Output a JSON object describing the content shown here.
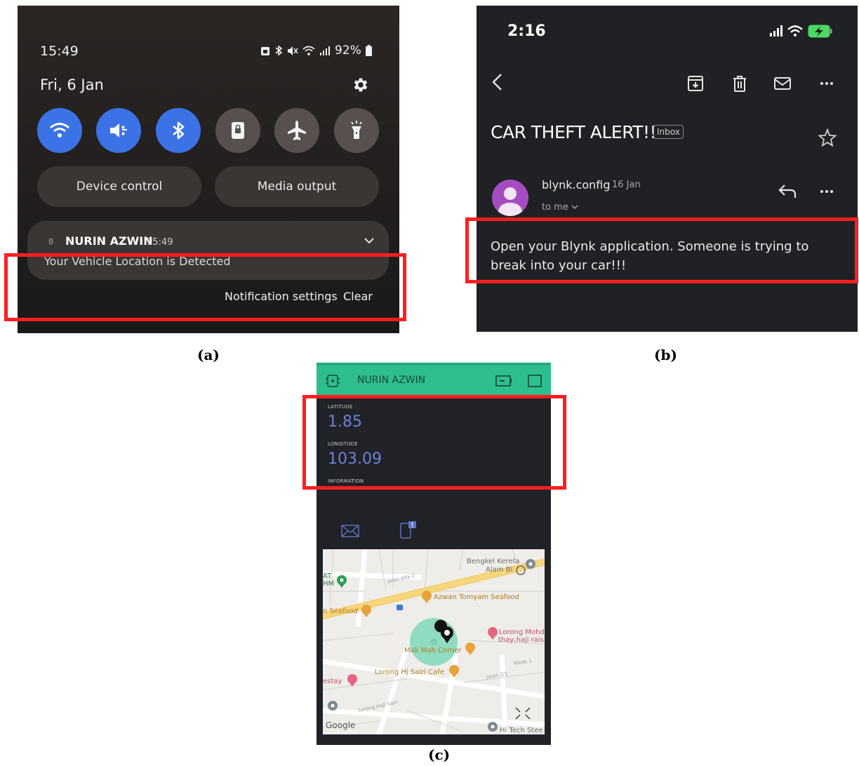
{
  "panel_a": {
    "time": "15:49",
    "battery": "92%",
    "date": "Fri, 6 Jan",
    "quick_settings": [
      {
        "icon": "wifi-icon",
        "on": true
      },
      {
        "icon": "sound-muted-icon",
        "on": true
      },
      {
        "icon": "bluetooth-icon",
        "on": true
      },
      {
        "icon": "rotation-lock-icon",
        "on": false
      },
      {
        "icon": "airplane-icon",
        "on": false
      },
      {
        "icon": "flashlight-icon",
        "on": false
      }
    ],
    "device_control": "Device control",
    "media_output": "Media output",
    "notification": {
      "app_icon_text": "B",
      "title": "NURIN AZWIN",
      "time": "15:49",
      "body": "Your Vehicle Location is Detected"
    },
    "notification_settings": "Notification settings",
    "clear": "Clear"
  },
  "panel_b": {
    "time": "2:16",
    "subject": "CAR THEFT ALERT!!",
    "label": "Inbox",
    "sender": "blynk.config",
    "date": "16 Jan",
    "to": "to me",
    "body": "Open your Blynk application. Someone is trying to break into your car!!!"
  },
  "panel_c": {
    "title": "NURIN AZWIN",
    "latitude_label": "LATITUDE",
    "latitude": "1.85",
    "longitude_label": "LONGITUDE",
    "longitude": "103.09",
    "information_label": "INFORMATION",
    "map_labels": {
      "bengkel": "Bengkel Kereta",
      "alam": "Alam Bi",
      "at": "AT",
      "hm": "HM",
      "jalan_alfa": "Jalan Alfa 2",
      "azwan": "Azwan Tomyam Seafood",
      "seafood": "n Seafood",
      "lorong_mohd": "Lorong Mohd",
      "thay": "thay,haji rais",
      "mak_mah": "Mak Mah Corner",
      "rizab": "Rizab 1",
      "lorong_sairi": "Lorong Hj Sairi Cafe",
      "jalan21": "Jalan 2/1",
      "estay": "estay",
      "lorong_haji": "Lorong Haji Sairi",
      "google": "Google",
      "hitech": "Hi Tech Stee"
    }
  },
  "captions": {
    "a": "(a)",
    "b": "(b)",
    "c": "(c)"
  }
}
